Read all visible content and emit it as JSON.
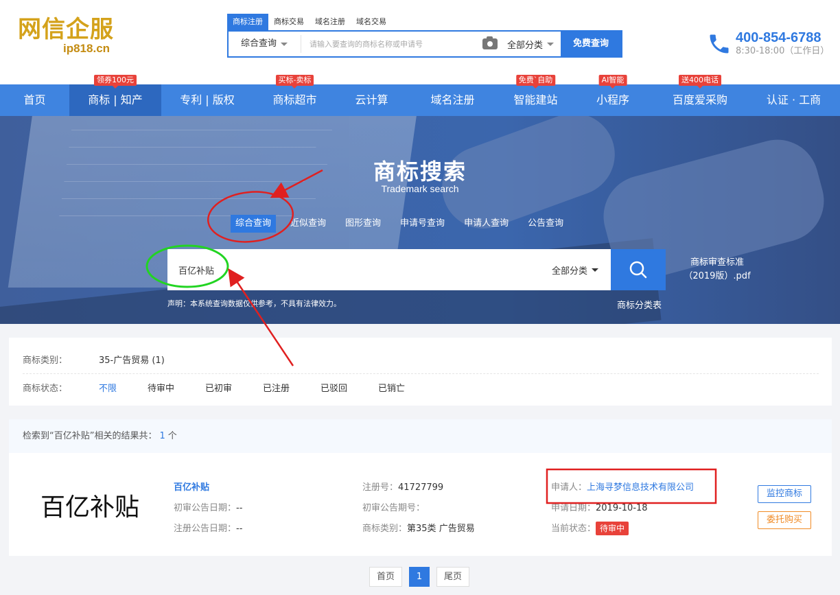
{
  "header": {
    "logo_main": "网信企服",
    "logo_sub": "ip818.cn",
    "search_tabs": [
      "商标注册",
      "商标交易",
      "域名注册",
      "域名交易"
    ],
    "search_type": "综合查询",
    "search_placeholder": "请输入要查询的商标名称或申请号",
    "category": "全部分类",
    "search_button": "免费查询",
    "phone": "400-854-6788",
    "hours": "8:30-18:00（工作日）"
  },
  "nav": {
    "items": [
      {
        "label": "首页",
        "badge": ""
      },
      {
        "label": "商标 | 知产",
        "badge": "领券100元"
      },
      {
        "label": "专利 | 版权",
        "badge": ""
      },
      {
        "label": "商标超市",
        "badge": "买标-卖标"
      },
      {
        "label": "云计算",
        "badge": ""
      },
      {
        "label": "域名注册",
        "badge": ""
      },
      {
        "label": "智能建站",
        "badge": "免费`自助"
      },
      {
        "label": "小程序",
        "badge": "AI智能"
      },
      {
        "label": "百度爱采购",
        "badge": "送400电话"
      },
      {
        "label": "认证 · 工商",
        "badge": ""
      }
    ]
  },
  "banner": {
    "title": "商标搜索",
    "subtitle": "Trademark search",
    "tabs": [
      "综合查询",
      "近似查询",
      "图形查询",
      "申请号查询",
      "申请人查询",
      "公告查询"
    ],
    "search_value": "百亿补贴",
    "category": "全部分类",
    "disclaimer": "声明：本系统查询数据仅供参考，不具有法律效力。",
    "pdf_link": "商标审查标准（2019版）.pdf",
    "class_link": "商标分类表"
  },
  "filters": {
    "category_label": "商标类别：",
    "category_value": "35-广告贸易 (1)",
    "status_label": "商标状态：",
    "status_options": [
      "不限",
      "待审中",
      "已初审",
      "已注册",
      "已驳回",
      "已销亡"
    ]
  },
  "results": {
    "summary_prefix": "检索到“百亿补贴”相关的结果共：",
    "count": "1",
    "summary_suffix": "个",
    "items": [
      {
        "image_text": "百亿补贴",
        "name": "百亿补贴",
        "first_pub_date_label": "初审公告日期：",
        "first_pub_date": "--",
        "reg_pub_date_label": "注册公告日期：",
        "reg_pub_date": "--",
        "reg_no_label": "注册号：",
        "reg_no": "41727799",
        "first_pub_issue_label": "初审公告期号：",
        "first_pub_issue": "",
        "class_label": "商标类别：",
        "class_value": "第35类 广告贸易",
        "applicant_label": "申请人：",
        "applicant": "上海寻梦信息技术有限公司",
        "apply_date_label": "申请日期：",
        "apply_date": "2019-10-18",
        "status_label": "当前状态：",
        "status": "待审中",
        "monitor_button": "监控商标",
        "buy_button": "委托购买"
      }
    ]
  },
  "pagination": {
    "first": "首页",
    "current": "1",
    "last": "尾页"
  },
  "colors": {
    "primary": "#2f79e0",
    "nav": "#3f84e0",
    "badge": "#e8423a",
    "buy": "#f08a24",
    "logo": "#d4a21b"
  }
}
